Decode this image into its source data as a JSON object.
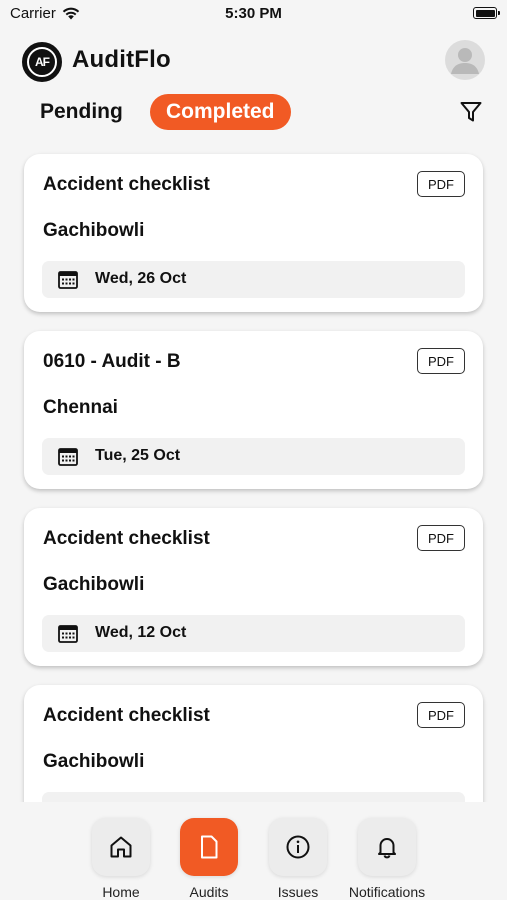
{
  "status_bar": {
    "carrier": "Carrier",
    "time": "5:30 PM",
    "icons": [
      "wifi-icon",
      "battery-icon"
    ]
  },
  "header": {
    "logo_text": "AF",
    "title": "AuditFlo",
    "avatar_icon": "user-icon"
  },
  "tabs": {
    "pending_label": "Pending",
    "completed_label": "Completed",
    "active": "Completed",
    "filter_icon": "filter-icon"
  },
  "audits": [
    {
      "title": "Accident checklist",
      "location": "Gachibowli",
      "date": "Wed, 26 Oct",
      "pdf_label": "PDF"
    },
    {
      "title": "0610 - Audit - B",
      "location": "Chennai",
      "date": "Tue, 25 Oct",
      "pdf_label": "PDF"
    },
    {
      "title": "Accident checklist",
      "location": "Gachibowli",
      "date": "Wed, 12 Oct",
      "pdf_label": "PDF"
    },
    {
      "title": "Accident checklist",
      "location": "Gachibowli",
      "date": "",
      "pdf_label": "PDF"
    }
  ],
  "nav": {
    "items": [
      {
        "label": "Home",
        "icon": "home-icon"
      },
      {
        "label": "Audits",
        "icon": "document-icon"
      },
      {
        "label": "Issues",
        "icon": "info-icon"
      },
      {
        "label": "Notifications",
        "icon": "bell-icon"
      }
    ],
    "active": "Audits"
  },
  "colors": {
    "accent": "#f15a24",
    "background": "#f5f5f5",
    "card": "#ffffff"
  }
}
